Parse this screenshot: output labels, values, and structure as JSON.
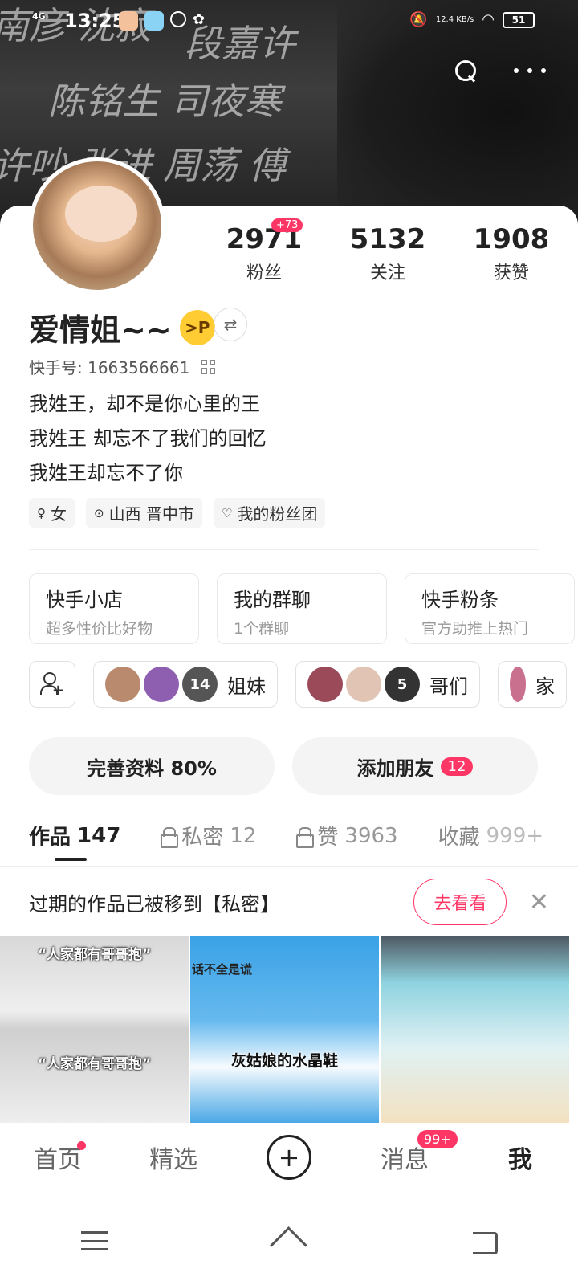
{
  "status_bar": {
    "network": "4G",
    "time": "13:25",
    "speed": "12.4 KB/s",
    "battery": "51"
  },
  "profile": {
    "stats": [
      {
        "num": "2971",
        "label": "粉丝",
        "badge": "+73"
      },
      {
        "num": "5132",
        "label": "关注"
      },
      {
        "num": "1908",
        "label": "获赞"
      }
    ],
    "nickname": "爱情姐~~",
    "uid": "快手号: 1663566661",
    "bio": [
      "我姓王，却不是你心里的王",
      "我姓王 却忘不了我们的回忆",
      "我姓王却忘不了你"
    ],
    "tags": [
      {
        "icon": "female-icon",
        "label": "女"
      },
      {
        "icon": "location-icon",
        "label": "山西 晋中市"
      },
      {
        "icon": "heart-icon",
        "label": "我的粉丝团"
      }
    ]
  },
  "features": [
    {
      "title": "快手小店",
      "sub": "超多性价比好物"
    },
    {
      "title": "我的群聊",
      "sub": "1个群聊"
    },
    {
      "title": "快手粉条",
      "sub": "官方助推上热门"
    }
  ],
  "groups": [
    {
      "label": "姐妹",
      "count": "14"
    },
    {
      "label": "哥们",
      "count": "5"
    },
    {
      "label": "家"
    }
  ],
  "actions": {
    "complete": "完善资料 80%",
    "add_friend": "添加朋友",
    "add_friend_badge": "12"
  },
  "tabs": [
    {
      "label": "作品",
      "count": "147"
    },
    {
      "label": "私密",
      "count": "12"
    },
    {
      "label": "赞",
      "count": "3963"
    },
    {
      "label": "收藏",
      "count": "999+"
    }
  ],
  "notice": {
    "text": "过期的作品已被移到【私密】",
    "button": "去看看"
  },
  "videos": [
    {
      "caption_top": "“人家都有哥哥抱”",
      "caption_bottom": "“人家都有哥哥抱”"
    },
    {
      "caption_top": "话不全是谎",
      "caption_bottom": "灰姑娘的水晶鞋"
    },
    {}
  ],
  "bottom_nav": {
    "home": "首页",
    "featured": "精选",
    "messages": "消息",
    "messages_badge": "99+",
    "me": "我"
  }
}
